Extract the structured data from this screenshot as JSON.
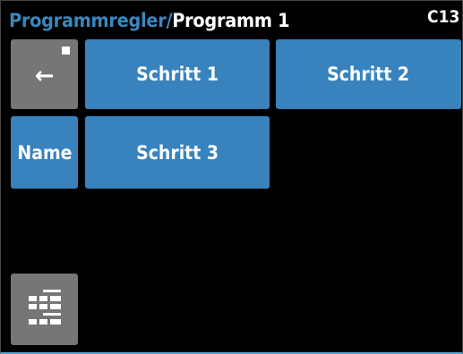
{
  "header": {
    "parent": "Programmregler",
    "separator": "/",
    "current": "Programm 1",
    "code": "C13"
  },
  "buttons": {
    "back": {
      "icon": "back-arrow-icon",
      "glyph": "←"
    },
    "step1": "Schritt 1",
    "step2": "Schritt 2",
    "name": "Name",
    "step3": "Schritt 3",
    "keypad": {
      "icon": "keypad-icon"
    }
  },
  "colors": {
    "accent": "#3883bd",
    "header_parent": "#3a87bd",
    "gray_button": "#767676",
    "background": "#000000"
  }
}
